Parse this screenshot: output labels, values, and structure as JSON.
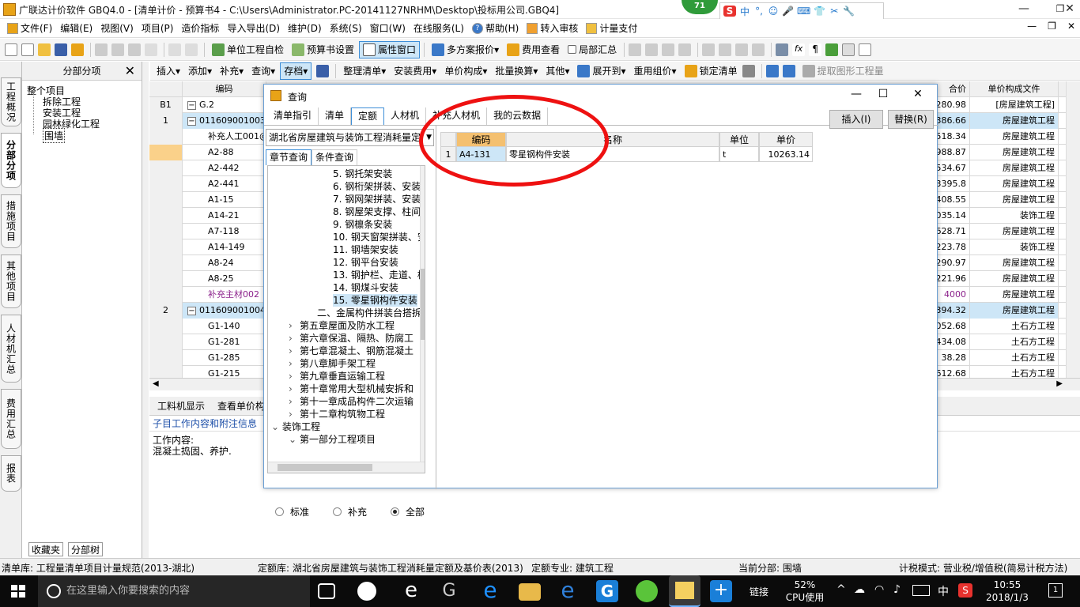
{
  "app": {
    "title": "广联达计价软件 GBQ4.0 - [清单计价 - 预算书4 - C:\\Users\\Administrator.PC-20141127NRHM\\Desktop\\投标用公司.GBQ4]",
    "badge": "71",
    "ime": [
      "中",
      "°,",
      "☺",
      "🎤",
      "⌨",
      "👕",
      "✂",
      "🔧"
    ],
    "window_controls": [
      "—",
      "❐",
      "✕"
    ]
  },
  "menu": {
    "items": [
      "文件(F)",
      "编辑(E)",
      "视图(V)",
      "项目(P)",
      "造价指标",
      "导入导出(D)",
      "维护(D)",
      "系统(S)",
      "窗口(W)",
      "在线服务(L)",
      "帮助(H)",
      "转入审核",
      "计量支付"
    ],
    "right": [
      "—",
      "❐",
      "✕"
    ]
  },
  "toolbar1": {
    "items": [
      "单位工程自检",
      "预算书设置",
      "属性窗口",
      "多方案报价",
      "费用查看",
      "局部汇总"
    ]
  },
  "toolbar2": {
    "items": [
      "插入",
      "添加",
      "补充",
      "查询",
      "存档",
      "整理清单",
      "安装费用",
      "单价构成",
      "批量换算",
      "其他",
      "展开到",
      "重用组价",
      "锁定清单",
      "提取图形工程量"
    ]
  },
  "left_tabs": [
    "工程概况",
    "分部分项",
    "措施项目",
    "其他项目",
    "人材机汇总",
    "费用汇总",
    "报表"
  ],
  "left_panel": {
    "title": "分部分项",
    "close": "✕",
    "tree": [
      "整个项目",
      "拆除工程",
      "安装工程",
      "园林绿化工程",
      "围墙"
    ],
    "bottom_tabs": [
      "收藏夹",
      "分部树"
    ]
  },
  "grid": {
    "header_code": "编码",
    "header_price": "合价",
    "header_file": "单价构成文件",
    "rows": [
      {
        "no": "B1",
        "code": "G.2",
        "expand": "−",
        "price": "280.98",
        "file": "[房屋建筑工程]",
        "hl": false
      },
      {
        "no": "1",
        "code": "011609001003",
        "expand": "−",
        "price": "386.66",
        "file": "房屋建筑工程",
        "hl": true
      },
      {
        "no": "",
        "code": "补充人工001@",
        "expand": "",
        "price": "518.34",
        "file": "房屋建筑工程",
        "hl": false
      },
      {
        "no": "",
        "code": "A2-88",
        "expand": "",
        "price": "988.87",
        "file": "房屋建筑工程",
        "hl": false
      },
      {
        "no": "",
        "code": "A2-442",
        "expand": "",
        "price": "534.67",
        "file": "房屋建筑工程",
        "hl": false
      },
      {
        "no": "",
        "code": "A2-441",
        "expand": "",
        "price": "3395.8",
        "file": "房屋建筑工程",
        "hl": false
      },
      {
        "no": "",
        "code": "A1-15",
        "expand": "",
        "price": "408.55",
        "file": "房屋建筑工程",
        "hl": false
      },
      {
        "no": "",
        "code": "A14-21",
        "expand": "",
        "price": "035.14",
        "file": "装饰工程",
        "hl": false
      },
      {
        "no": "",
        "code": "A7-118",
        "expand": "",
        "price": "628.71",
        "file": "房屋建筑工程",
        "hl": false
      },
      {
        "no": "",
        "code": "A14-149",
        "expand": "",
        "price": "223.78",
        "file": "装饰工程",
        "hl": false
      },
      {
        "no": "",
        "code": "A8-24",
        "expand": "",
        "price": "290.97",
        "file": "房屋建筑工程",
        "hl": false
      },
      {
        "no": "",
        "code": "A8-25",
        "expand": "",
        "price": "221.96",
        "file": "房屋建筑工程",
        "hl": false
      },
      {
        "no": "",
        "code": "补充主材002",
        "expand": "",
        "price": "4000",
        "file": "房屋建筑工程",
        "hl": false,
        "purple": true
      },
      {
        "no": "2",
        "code": "011609001004",
        "expand": "−",
        "price": "394.32",
        "file": "房屋建筑工程",
        "hl": true
      },
      {
        "no": "",
        "code": "G1-140",
        "expand": "",
        "price": "052.68",
        "file": "土石方工程",
        "hl": false
      },
      {
        "no": "",
        "code": "G1-281",
        "expand": "",
        "price": "434.08",
        "file": "土石方工程",
        "hl": false
      },
      {
        "no": "",
        "code": "G1-285",
        "expand": "",
        "price": "38.28",
        "file": "土石方工程",
        "hl": false
      },
      {
        "no": "",
        "code": "G1-215",
        "expand": "",
        "price": "612.68",
        "file": "土石方工程",
        "hl": false
      }
    ]
  },
  "bottom": {
    "tabs": [
      "工料机显示",
      "查看单价构"
    ],
    "subheader": "子目工作内容和附注信息",
    "content_label": "工作内容:",
    "content_text": "混凝土捣固、养护."
  },
  "dialog": {
    "title": "查询",
    "tabs": [
      "清单指引",
      "清单",
      "定额",
      "人材机",
      "补充人材机",
      "我的云数据"
    ],
    "insert_btn": "插入(I)",
    "replace_btn": "替换(R)",
    "library": "湖北省房屋建筑与装饰工程消耗量定",
    "subtabs": [
      "章节查询",
      "条件查询"
    ],
    "tree": [
      {
        "t": "5. 钢托架安装",
        "lv": 3
      },
      {
        "t": "6. 钢桁架拼装、安装",
        "lv": 3
      },
      {
        "t": "7. 钢网架拼装、安装",
        "lv": 3
      },
      {
        "t": "8. 钢屋架支撑、柱间",
        "lv": 3
      },
      {
        "t": "9. 钢檩条安装",
        "lv": 3
      },
      {
        "t": "10. 钢天窗架拼装、安",
        "lv": 3
      },
      {
        "t": "11. 钢墙架安装",
        "lv": 3
      },
      {
        "t": "12. 钢平台安装",
        "lv": 3
      },
      {
        "t": "13. 钢护栏、走道、梯",
        "lv": 3
      },
      {
        "t": "14. 钢煤斗安装",
        "lv": 3
      },
      {
        "t": "15. 零星钢构件安装",
        "lv": 3,
        "sel": true
      },
      {
        "t": "二、金属构件拼装台搭拆",
        "lv": 2
      },
      {
        "t": "第五章屋面及防水工程",
        "lv": 1,
        "exp": "›"
      },
      {
        "t": "第六章保温、隔热、防腐工",
        "lv": 1,
        "exp": "›"
      },
      {
        "t": "第七章混凝土、钢筋混凝土",
        "lv": 1,
        "exp": "›"
      },
      {
        "t": "第八章脚手架工程",
        "lv": 1,
        "exp": "›"
      },
      {
        "t": "第九章垂直运输工程",
        "lv": 1,
        "exp": "›"
      },
      {
        "t": "第十章常用大型机械安拆和",
        "lv": 1,
        "exp": "›"
      },
      {
        "t": "第十一章成品构件二次运输",
        "lv": 1,
        "exp": "›"
      },
      {
        "t": "第十二章构筑物工程",
        "lv": 1,
        "exp": "›"
      },
      {
        "t": "装饰工程",
        "lv": 0,
        "exp": "⌄"
      },
      {
        "t": "第一部分工程项目",
        "lv": 1,
        "exp": "⌄"
      }
    ],
    "radios": [
      "标准",
      "补充",
      "全部"
    ],
    "result_headers": [
      "编码",
      "名称",
      "单位",
      "单价"
    ],
    "result_rows": [
      {
        "no": "1",
        "code": "A4-131",
        "name": "零星钢构件安装",
        "unit": "t",
        "price": "10263.14"
      }
    ]
  },
  "status": {
    "list_lib": "清单库: 工程量清单项目计量规范(2013-湖北)",
    "quota_lib": "定额库: 湖北省房屋建筑与装饰工程消耗量定额及基价表(2013)",
    "quota_major": "定额专业: 建筑工程",
    "current": "当前分部: 围墙",
    "tax": "计税模式: 营业税/增值税(简易计税方法)"
  },
  "taskbar": {
    "search_placeholder": "在这里输入你要搜索的内容",
    "link": "链接",
    "cpu_pct": "52%",
    "cpu_label": "CPU使用",
    "ime": "中",
    "time": "10:55",
    "date": "2018/1/3",
    "notif": "1"
  },
  "colors": {
    "highlight_row": "#cde6f7",
    "header_orange": "#f4c070",
    "annotation_red": "#ee1111"
  }
}
